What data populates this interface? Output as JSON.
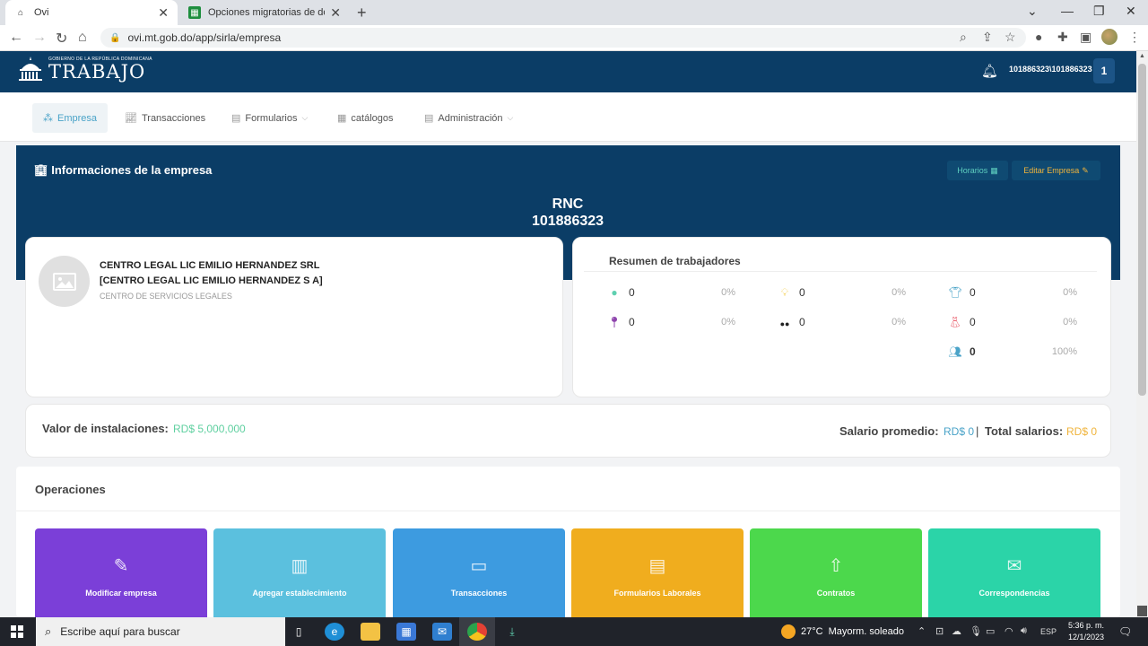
{
  "browser": {
    "tabs": [
      {
        "title": "Ovi",
        "active": true
      },
      {
        "title": "Opciones migratorias de dominio",
        "active": false
      }
    ],
    "url": "ovi.mt.gob.do/app/sirla/empresa"
  },
  "header": {
    "logo_small": "GOBIERNO DE LA REPÚBLICA DOMINICANA",
    "logo_big": "TRABAJO",
    "user": "101886323\\101886323",
    "user_badge": "1"
  },
  "menu": [
    {
      "label": "Empresa",
      "icon": "sitemap-icon"
    },
    {
      "label": "Transacciones",
      "icon": "chart-icon"
    },
    {
      "label": "Formularios",
      "icon": "document-icon"
    },
    {
      "label": "catálogos",
      "icon": "table-icon"
    },
    {
      "label": "Administración",
      "icon": "list-icon"
    }
  ],
  "company": {
    "section_title": "Informaciones de la empresa",
    "horarios_label": "Horarios",
    "editar_label": "Editar Empresa",
    "rnc_label": "RNC",
    "rnc_value": "101886323",
    "name_line1": "CENTRO LEGAL LIC EMILIO HERNANDEZ SRL",
    "name_line2": "[CENTRO LEGAL LIC EMILIO HERNANDEZ S A]",
    "sector": "CENTRO DE SERVICIOS LEGALES"
  },
  "resumen": {
    "title": "Resumen de trabajadores",
    "stats": [
      {
        "icon": "globe-icon",
        "value": "0",
        "pct": "0%",
        "color": "#5fd0b0"
      },
      {
        "icon": "bulb-icon",
        "value": "0",
        "pct": "0%",
        "color": "#f5d76e"
      },
      {
        "icon": "male-shirt-icon",
        "value": "0",
        "pct": "0%",
        "color": "#4aa3c8"
      },
      {
        "icon": "location-icon",
        "value": "0",
        "pct": "0%",
        "color": "#8e44ad"
      },
      {
        "icon": "glasses-icon",
        "value": "0",
        "pct": "0%",
        "color": "#222222"
      },
      {
        "icon": "female-dress-icon",
        "value": "0",
        "pct": "0%",
        "color": "#e74c5c"
      },
      {
        "icon": "users-icon",
        "value": "0",
        "pct": "100%",
        "color": "#4aa3c8"
      }
    ]
  },
  "valores": {
    "instalaciones_label": "Valor de instalaciones:",
    "instalaciones_value": "RD$ 5,000,000",
    "salario_label": "Salario promedio:",
    "salario_value": "RD$ 0",
    "separator": "|",
    "total_label": "Total salarios:",
    "total_value": "RD$ 0"
  },
  "operaciones": {
    "title": "Operaciones",
    "tiles": [
      {
        "label": "Modificar empresa",
        "icon": "edit-icon",
        "color": "#7b3fd8"
      },
      {
        "label": "Agregar establecimiento",
        "icon": "building-icon",
        "color": "#5bc0de"
      },
      {
        "label": "Transacciones",
        "icon": "credit-card-icon",
        "color": "#3d9be0"
      },
      {
        "label": "Formularios Laborales",
        "icon": "file-icon",
        "color": "#f0ad1e"
      },
      {
        "label": "Contratos",
        "icon": "file-upload-icon",
        "color": "#4cd84c"
      },
      {
        "label": "Correspondencias",
        "icon": "envelope-icon",
        "color": "#2bd4a8"
      }
    ]
  },
  "taskbar": {
    "search_placeholder": "Escribe aquí para buscar",
    "weather_temp": "27°C",
    "weather_text": "Mayorm. soleado",
    "language": "ESP",
    "time": "5:36 p. m.",
    "date": "12/1/2023"
  }
}
